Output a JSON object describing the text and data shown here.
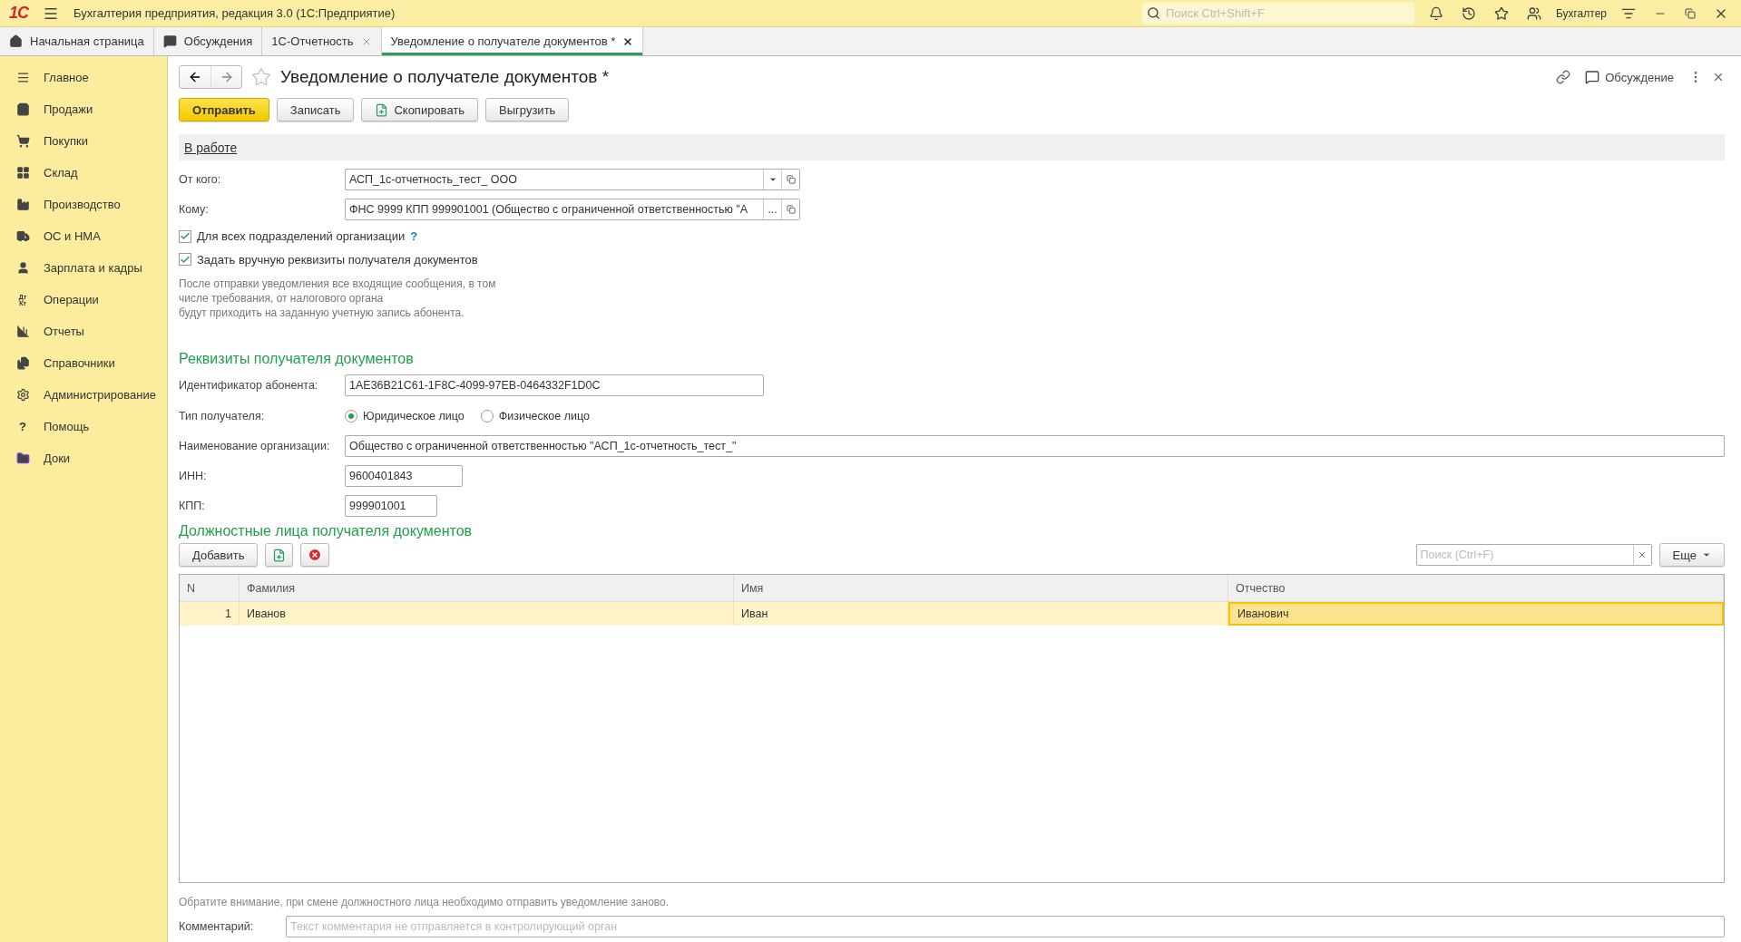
{
  "app": {
    "logo": "1С",
    "title": "Бухгалтерия предприятия, редакция 3.0  (1С:Предприятие)",
    "search": {
      "placeholder": "Поиск Ctrl+Shift+F"
    },
    "user": "Бухгалтер"
  },
  "tabs": [
    {
      "label": "Начальная страница",
      "selected": false,
      "closable": false
    },
    {
      "label": "Обсуждения",
      "selected": false,
      "closable": false
    },
    {
      "label": "1С-Отчетность",
      "selected": false,
      "closable": true
    },
    {
      "label": "Уведомление о получателе документов *",
      "selected": true,
      "closable": true
    }
  ],
  "sidebar": {
    "items": [
      {
        "label": "Главное"
      },
      {
        "label": "Продажи"
      },
      {
        "label": "Покупки"
      },
      {
        "label": "Склад"
      },
      {
        "label": "Производство"
      },
      {
        "label": "ОС и НМА"
      },
      {
        "label": "Зарплата и кадры"
      },
      {
        "label": "Операции",
        "glyph": "Дт Кт"
      },
      {
        "label": "Отчеты"
      },
      {
        "label": "Справочники"
      },
      {
        "label": "Администрирование"
      },
      {
        "label": "Помощь",
        "glyph": "?"
      },
      {
        "label": "Доки"
      }
    ]
  },
  "form": {
    "title": "Уведомление о получателе документов *",
    "discussion": "Обсуждение",
    "buttons": [
      {
        "label": "Отправить",
        "kind": "primary"
      },
      {
        "label": "Записать",
        "kind": "plain"
      },
      {
        "label": "Скопировать",
        "kind": "copy"
      },
      {
        "label": "Выгрузить",
        "kind": "plain"
      }
    ],
    "status": "В работе",
    "from": {
      "label": "От кого:",
      "value": "АСП_1с-отчетность_тест_ ООО"
    },
    "to": {
      "label": "Кому:",
      "value": "ФНС 9999 КПП 999901001 (Общество с ограниченной ответственностью \"А",
      "more": "..."
    },
    "checkboxes": [
      {
        "label": "Для всех подразделений организации",
        "checked": true,
        "help": "?"
      },
      {
        "label": "Задать вручную реквизиты получателя документов",
        "checked": true
      }
    ],
    "note": [
      "После отправки уведомления все входящие сообщения, в том",
      "числе требования, от налогового органа",
      "будут приходить на заданную учетную запись абонента."
    ],
    "recipient": {
      "heading": "Реквизиты получателя документов",
      "subscriber_id": {
        "label": "Идентификатор абонента:",
        "value": "1AE36B21C61-1F8C-4099-97EB-0464332F1D0C"
      },
      "type": {
        "label": "Тип получателя:",
        "options": [
          {
            "label": "Юридическое лицо",
            "selected": true
          },
          {
            "label": "Физическое лицо",
            "selected": false
          }
        ]
      },
      "org_name": {
        "label": "Наименование организации:",
        "value": "Общество с ограниченной ответственностью \"АСП_1с-отчетность_тест_\""
      },
      "inn": {
        "label": "ИНН:",
        "value": "9600401843"
      },
      "kpp": {
        "label": "КПП:",
        "value": "999901001"
      }
    },
    "officials": {
      "heading": "Должностные лица получателя документов",
      "add": "Добавить",
      "search": {
        "placeholder": "Поиск (Ctrl+F)"
      },
      "more": "Еще",
      "table": {
        "columns": [
          "N",
          "Фамилия",
          "Имя",
          "Отчество"
        ],
        "rows": [
          {
            "selected": true,
            "cells": [
              {
                "text": "1",
                "current": false
              },
              {
                "text": "Иванов",
                "current": false
              },
              {
                "text": "Иван",
                "current": false
              },
              {
                "text": "Иванович",
                "current": true
              }
            ]
          }
        ]
      }
    },
    "footnote": "Обратите внимание, при смене должностного лица необходимо отправить уведомление заново.",
    "comment": {
      "label": "Комментарий:",
      "placeholder": "Текст комментария не отправляется в контролирующий орган"
    }
  }
}
